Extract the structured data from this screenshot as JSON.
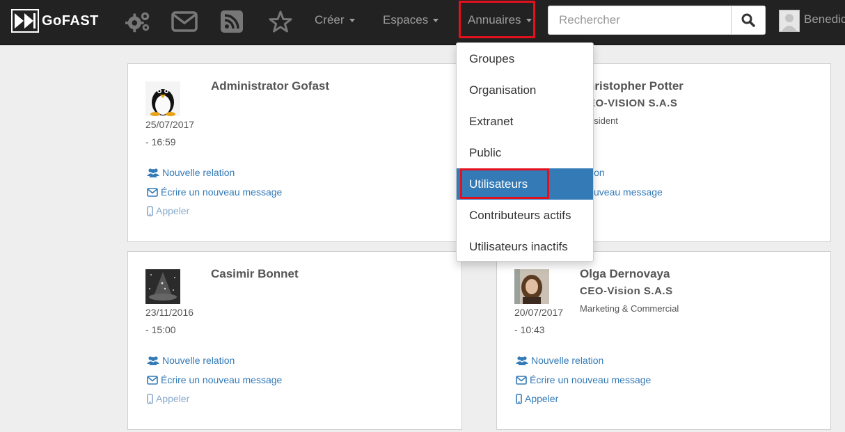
{
  "brand": {
    "name": "GoFAST"
  },
  "navbar": {
    "icons": [
      "gears-icon",
      "envelope-icon",
      "rss-icon",
      "star-icon"
    ],
    "creer_label": "Créer",
    "espaces_label": "Espaces",
    "annuaires_label": "Annuaires",
    "search_placeholder": "Rechercher",
    "user_name": "Benedic"
  },
  "dropdown": {
    "items": [
      {
        "label": "Groupes"
      },
      {
        "label": "Organisation"
      },
      {
        "label": "Extranet"
      },
      {
        "label": "Public"
      },
      {
        "label": "Utilisateurs",
        "selected": true
      },
      {
        "label": "Contributeurs actifs"
      },
      {
        "label": "Utilisateurs inactifs"
      }
    ]
  },
  "actions": {
    "relation": "Nouvelle relation",
    "message": "Écrire un nouveau message",
    "call": "Appeler"
  },
  "cards": [
    {
      "name": "Administrator Gofast",
      "company": "",
      "job": "",
      "date": "25/07/2017",
      "time": "- 16:59"
    },
    {
      "name": "hristopher Potter",
      "company": "EO-VISION S.A.S",
      "job": "ésident",
      "relation_partial": "ion",
      "message_partial": "uveau message"
    },
    {
      "name": "Casimir Bonnet",
      "company": "",
      "job": "",
      "date": "23/11/2016",
      "time": "- 15:00"
    },
    {
      "name": "Olga Dernovaya",
      "company": "CEO-Vision S.A.S",
      "job": "Marketing & Commercial",
      "date": "20/07/2017",
      "time": "- 10:43"
    }
  ],
  "colors": {
    "navbar": "#222222",
    "link": "#337ab7",
    "selected": "#337ab7",
    "highlight": "#e3101d"
  }
}
